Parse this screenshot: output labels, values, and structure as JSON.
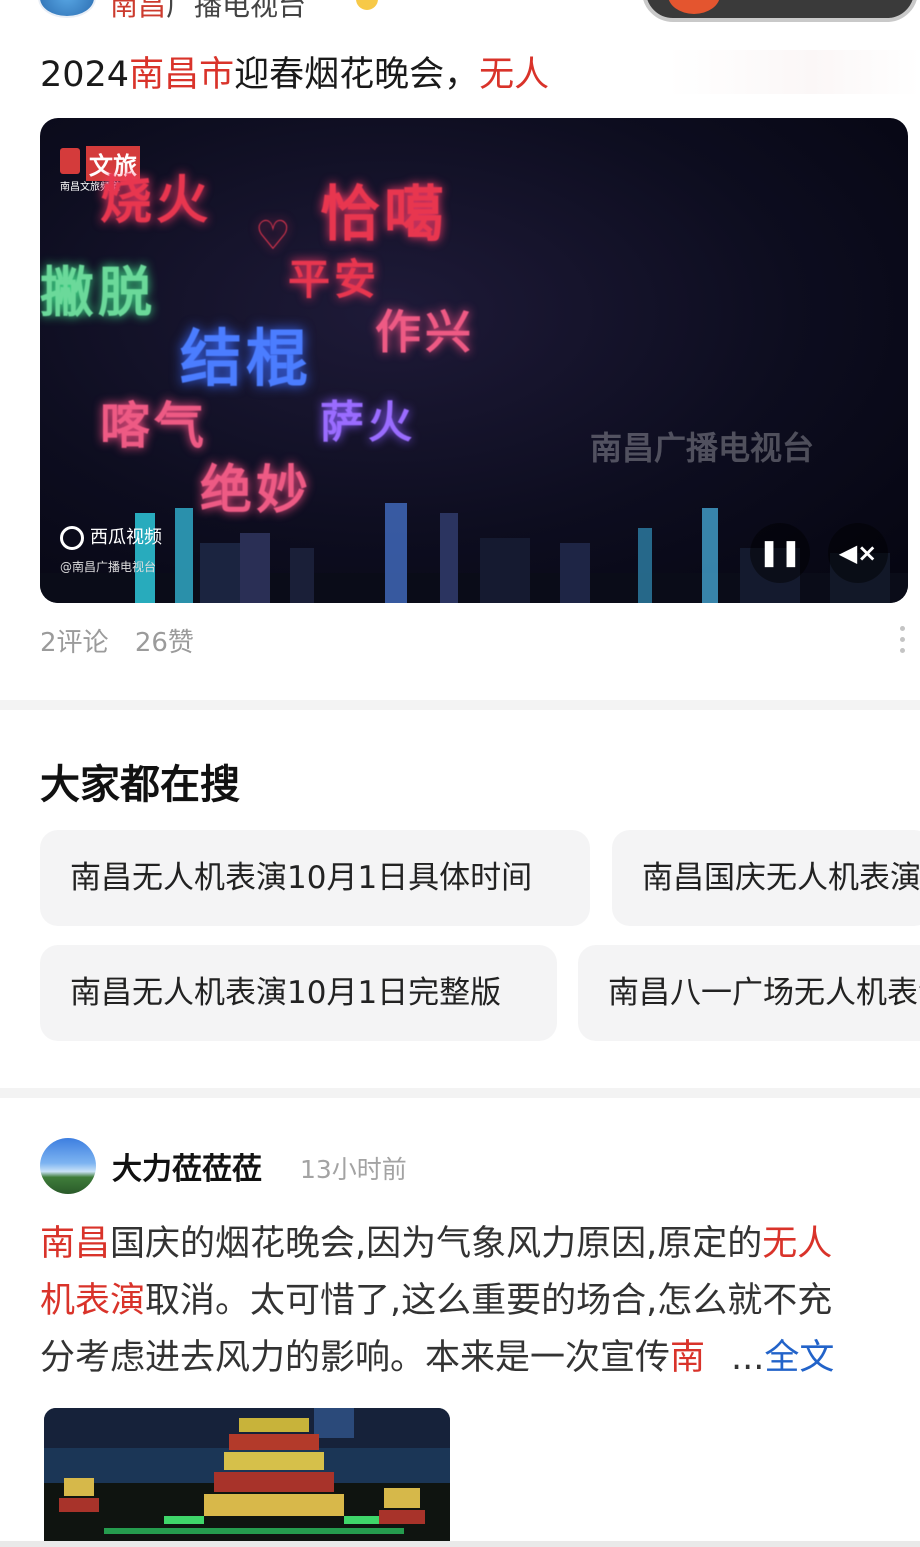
{
  "top_header": {
    "name_highlight": "南昌",
    "name_rest": "广播电视台"
  },
  "post": {
    "title_parts": [
      "2024",
      "南昌市",
      "迎春烟花晚会，",
      "无人"
    ],
    "video": {
      "logo_text": "文旅",
      "logo_sub": "南昌文旅频道",
      "overlay_texts": [
        {
          "text": "烧火",
          "color": "red"
        },
        {
          "text": "恰噶",
          "color": "red"
        },
        {
          "text": "平安",
          "color": "red"
        },
        {
          "text": "撇脱",
          "color": "green"
        },
        {
          "text": "结棍",
          "color": "blue"
        },
        {
          "text": "作兴",
          "color": "pink"
        },
        {
          "text": "喀气",
          "color": "pink"
        },
        {
          "text": "萨火",
          "color": "purple"
        },
        {
          "text": "绝妙",
          "color": "pink"
        }
      ],
      "watermark": "南昌广播电视台",
      "source_label": "西瓜视频",
      "credit": "@南昌广播电视台",
      "pause_icon": "pause-icon",
      "mute_icon": "mute-icon"
    },
    "comments": "2评论",
    "likes": "26赞"
  },
  "searches": {
    "title": "大家都在搜",
    "chips": [
      "南昌无人机表演10月1日具体时间",
      "南昌国庆无人机表演",
      "南昌无人机表演10月1日完整版",
      "南昌八一广场无人机表演"
    ]
  },
  "post2": {
    "author": "大力莅莅莅",
    "time": "13小时前",
    "lines": [
      [
        {
          "t": "南昌",
          "hl": true
        },
        {
          "t": "国庆的烟花晚会,因为气象风力原因,原定的",
          "hl": false
        },
        {
          "t": "无人",
          "hl": true
        }
      ],
      [
        {
          "t": "机表演",
          "hl": true
        },
        {
          "t": "取消。太可惜了,这么重要的场合,怎么就不充",
          "hl": false
        }
      ],
      [
        {
          "t": "分考虑进去风力的影响。本来是一次宣传",
          "hl": false
        },
        {
          "t": "南",
          "hl": true
        }
      ]
    ],
    "ellipsis": "...",
    "full_text": "全文"
  }
}
